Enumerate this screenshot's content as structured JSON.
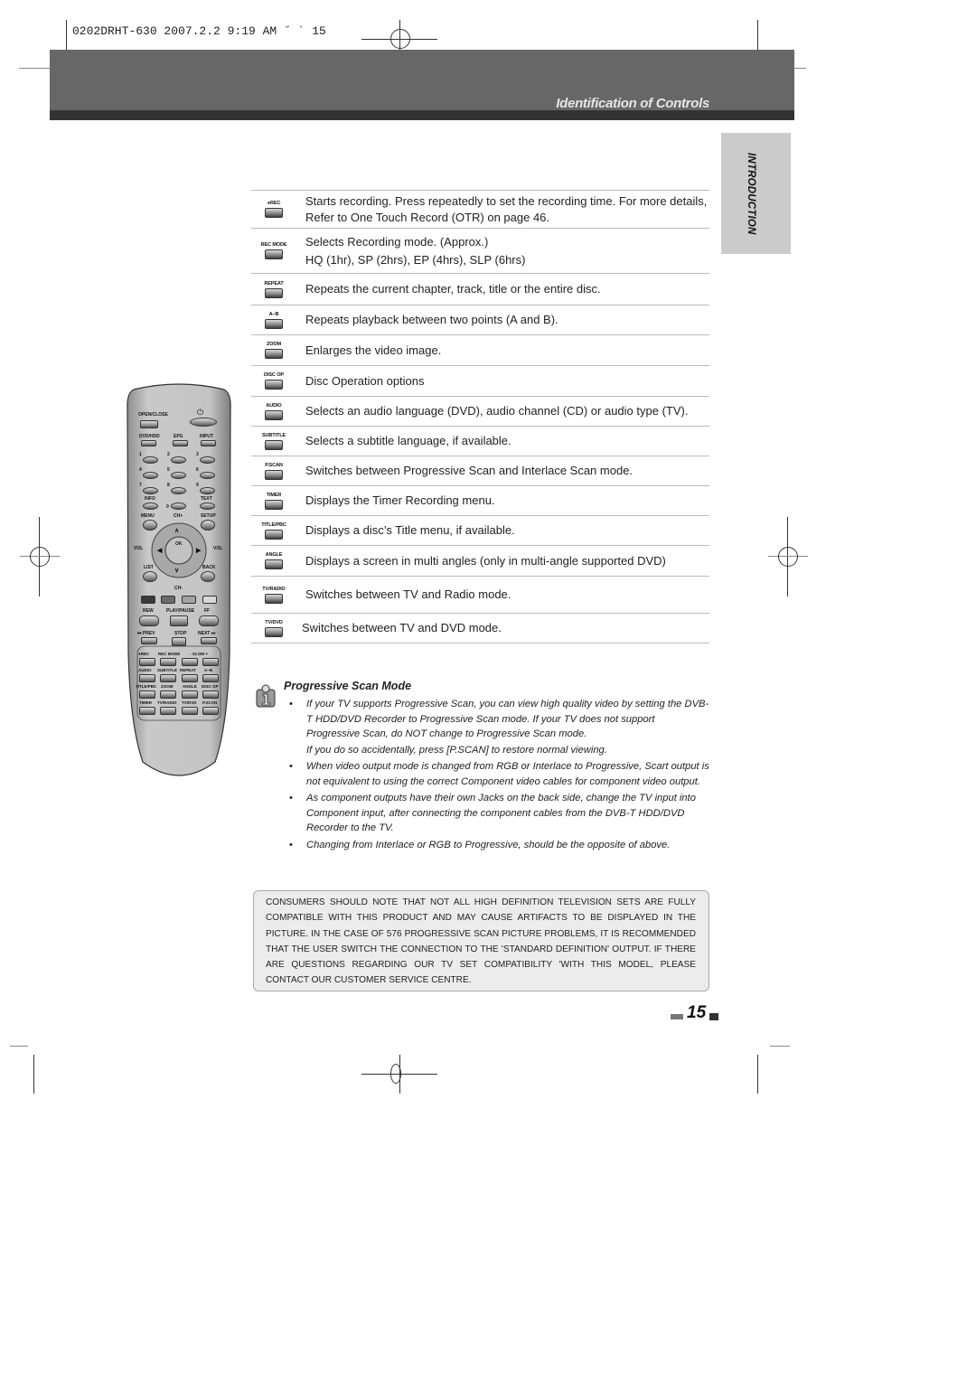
{
  "slug": {
    "text": "0202DRHT-630 2007.2.2 9:19 AM ˘  ˋ  15"
  },
  "header": {
    "section_title": "Identification of Controls",
    "side_tab": "INTRODUCTION"
  },
  "controls": [
    {
      "button": "●REC",
      "description": "Starts recording. Press repeatedly to set the recording time. For more details, Refer to One Touch Record (OTR) on page 46."
    },
    {
      "button": "REC MODE",
      "description": "Selects Recording mode. (Approx.)",
      "description2": "HQ (1hr), SP (2hrs), EP  (4hrs), SLP (6hrs)"
    },
    {
      "button": "REPEAT",
      "description": "Repeats the current chapter, track, title or the entire disc."
    },
    {
      "button": "A–B",
      "description": "Repeats playback between two points (A and B)."
    },
    {
      "button": "ZOOM",
      "description": "Enlarges the video image."
    },
    {
      "button": "DISC OP",
      "description": "Disc Operation options"
    },
    {
      "button": "AUDIO",
      "description": "Selects an audio language (DVD), audio channel (CD) or audio type (TV)."
    },
    {
      "button": "SUBTITLE",
      "description": "Selects a subtitle language, if available."
    },
    {
      "button": "P.SCAN",
      "description": "Switches between Progressive Scan and Interlace Scan mode."
    },
    {
      "button": "TIMER",
      "description": "Displays the Timer Recording menu."
    },
    {
      "button": "TITLE/PBC",
      "description": "Displays a disc’s Title menu, if available."
    },
    {
      "button": "ANGLE",
      "description": "Displays a screen in multi angles (only in multi-angle supported DVD)"
    },
    {
      "button": "TV/RADIO",
      "description": "Switches  between TV and Radio mode."
    },
    {
      "button": "TV/DVD",
      "description": "Switches  between TV and DVD mode."
    }
  ],
  "note": {
    "icon": "info-icon",
    "title": "Progressive Scan Mode",
    "items": [
      {
        "text": "If your TV supports Progressive Scan, you can view high quality video by setting the DVB-T HDD/DVD Recorder to Progressive Scan mode. If your TV does not support Progressive Scan, do NOT change to Progressive Scan mode.",
        "extra": "If you do so accidentally, press [P.SCAN] to restore normal viewing."
      },
      {
        "text": "When video output mode is changed from RGB or Interlace to Progressive, Scart output is not equivalent to using the correct Component video cables for component video output."
      },
      {
        "text": "As component outputs have their own Jacks on the back side, change the TV input into Component input, after connecting the component cables from the DVB-T HDD/DVD Recorder to the TV."
      },
      {
        "text": "Changing from Interlace or  RGB to Progressive, should be the opposite of above."
      }
    ]
  },
  "warning": {
    "text": "CONSUMERS SHOULD NOTE THAT NOT ALL HIGH DEFINITION TELEVISION SETS ARE FULLY COMPATIBLE WITH THIS PRODUCT AND MAY CAUSE ARTIFACTS TO BE DISPLAYED IN THE PICTURE. IN THE CASE OF 576 PROGRESSIVE SCAN PICTURE PROBLEMS, IT IS RECOMMENDED THAT THE USER SWITCH THE CONNECTION TO THE 'STANDARD DEFINITION' OUTPUT. IF THERE ARE QUESTIONS REGARDING OUR TV SET COMPATIBILITY 'WITH THIS MODEL, PLEASE CONTACT OUR CUSTOMER SERVICE CENTRE."
  },
  "page_number": "15",
  "remote": {
    "labels": {
      "open_close": "OPEN/CLOSE",
      "power": "⏻",
      "dvd_hdd": "DVD/HDD",
      "epg": "EPG",
      "input": "INPUT",
      "digits": [
        "1",
        "2",
        "3",
        "4",
        "5",
        "6",
        "7",
        "8",
        "9",
        "0"
      ],
      "info": "INFO",
      "text": "TEXT",
      "menu": "MENU",
      "ch_plus": "CH+",
      "setup": "SETUP",
      "vol_left": "VOL",
      "vol_right": "VOL",
      "ok": "OK",
      "list": "LIST",
      "back": "BACK",
      "ch_minus": "CH-",
      "rew": "REW",
      "play_pause": "PLAY/PAUSE",
      "ff": "FF",
      "prev": "⏮ PREV",
      "stop": "STOP",
      "next": "NEXT ⏭",
      "rec": "●REC",
      "rec_mode": "REC MODE",
      "slow": "- SLOW +",
      "audio": "AUDIO",
      "subtitle": "SUBTITLE",
      "repeat": "REPEAT",
      "ab": "A–B",
      "title_pbc": "TITLE/PBC",
      "zoom": "ZOOM",
      "angle": "ANGLE",
      "disc_op": "DISC OP",
      "timer": "TIMER",
      "tv_radio": "TV/RADIO",
      "tv_dvd": "TV/DVD",
      "p_scan": "P.SCAN"
    },
    "color_keys": [
      "#3a3a3a",
      "#6b6b6b",
      "#a3a3a3",
      "#d8d8d8"
    ]
  }
}
